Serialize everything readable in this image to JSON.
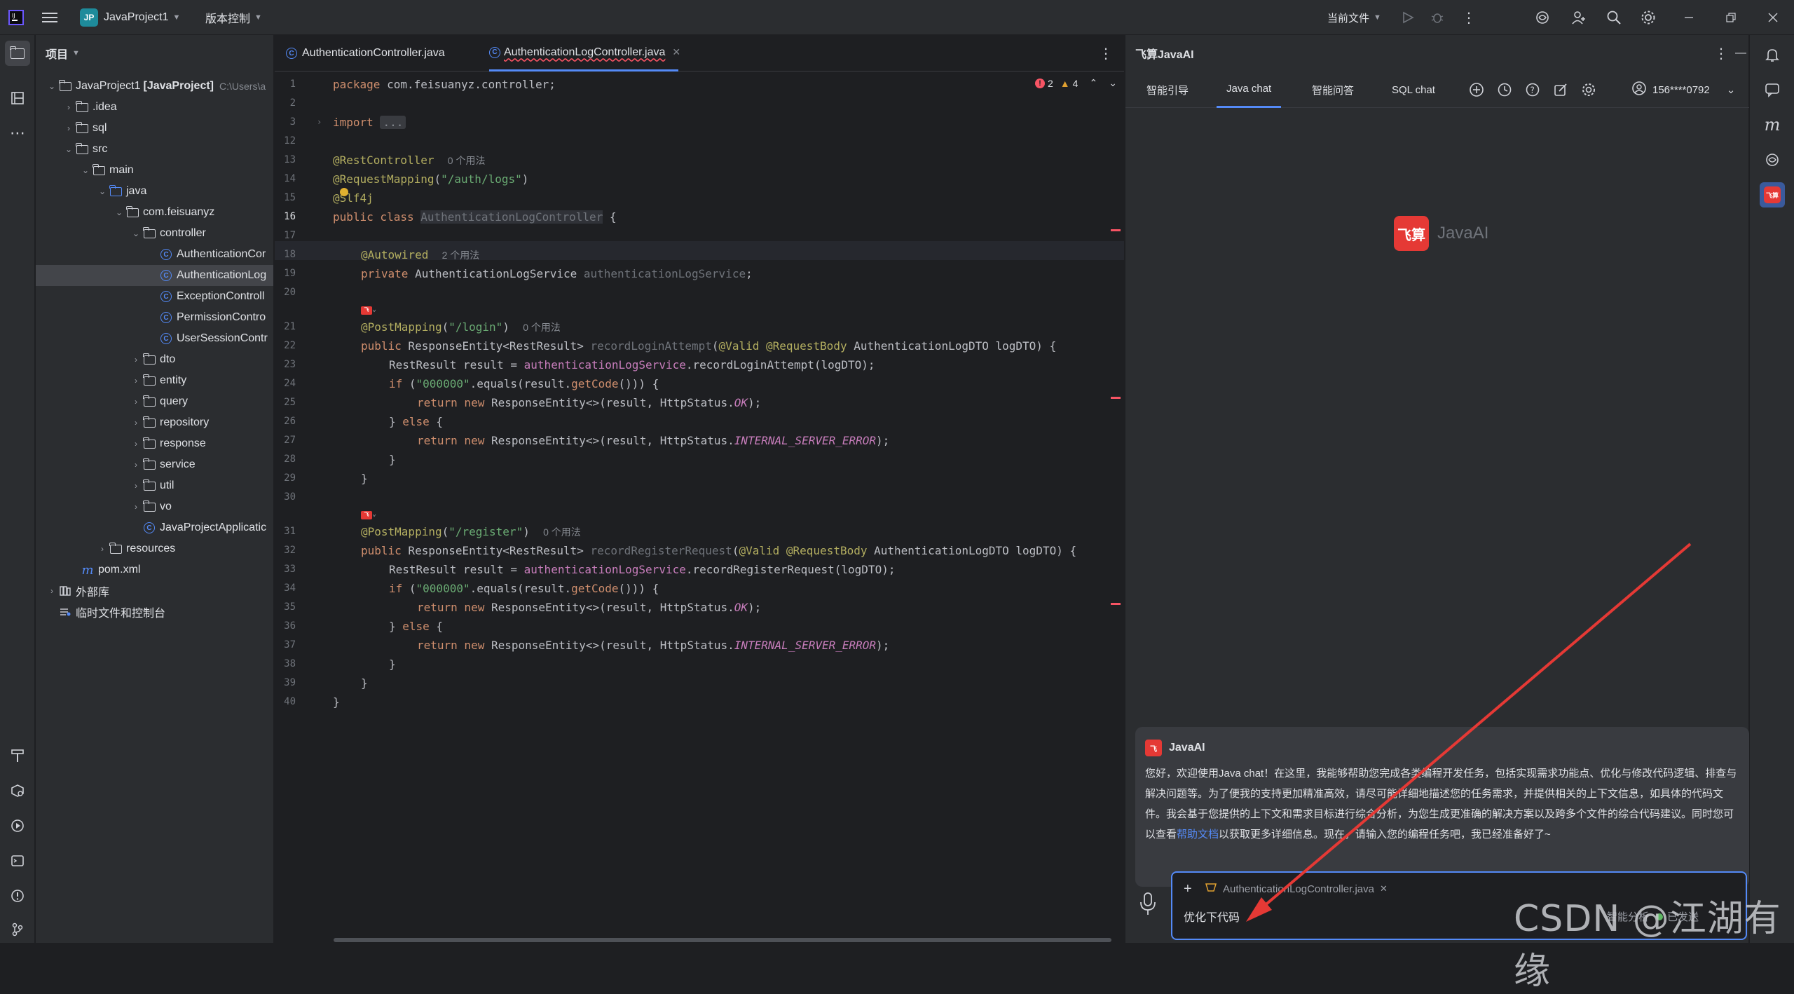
{
  "topbar": {
    "project_badge": "JP",
    "project_name": "JavaProject1",
    "vcs_label": "版本控制",
    "run_config": "当前文件"
  },
  "project_panel": {
    "title": "项目",
    "rows": [
      {
        "label": "JavaProject1",
        "extra": "[JavaProject]",
        "path": "C:\\Users\\a"
      },
      {
        "label": ".idea"
      },
      {
        "label": "sql"
      },
      {
        "label": "src"
      },
      {
        "label": "main"
      },
      {
        "label": "java"
      },
      {
        "label": "com.feisuanyz"
      },
      {
        "label": "controller"
      },
      {
        "label": "AuthenticationCor"
      },
      {
        "label": "AuthenticationLog"
      },
      {
        "label": "ExceptionControll"
      },
      {
        "label": "PermissionContro"
      },
      {
        "label": "UserSessionContr"
      },
      {
        "label": "dto"
      },
      {
        "label": "entity"
      },
      {
        "label": "query"
      },
      {
        "label": "repository"
      },
      {
        "label": "response"
      },
      {
        "label": "service"
      },
      {
        "label": "util"
      },
      {
        "label": "vo"
      },
      {
        "label": "JavaProjectApplicatic"
      },
      {
        "label": "resources"
      },
      {
        "label": "pom.xml"
      },
      {
        "label": "外部库"
      },
      {
        "label": "临时文件和控制台"
      }
    ]
  },
  "editor": {
    "tabs": [
      "AuthenticationController.java",
      "AuthenticationLogController.java"
    ],
    "errors": "2",
    "warnings": "4",
    "line_numbers": [
      "1",
      "2",
      "3",
      "12",
      "13",
      "14",
      "15",
      "16",
      "17",
      "18",
      "19",
      "20",
      "21",
      "22",
      "23",
      "24",
      "25",
      "26",
      "27",
      "28",
      "29",
      "30",
      "31",
      "32",
      "33",
      "34",
      "35",
      "36",
      "37",
      "38",
      "39",
      "40"
    ],
    "usages_2": "2 个用法",
    "usages_0": "0 个用法",
    "import_fold": "..."
  },
  "ai_panel": {
    "title": "飞算JavaAI",
    "tabs": [
      "智能引导",
      "Java chat",
      "智能问答",
      "SQL chat"
    ],
    "user": "156****0792",
    "logo_badge": "飞算",
    "logo_text": "JavaAI",
    "message": {
      "sender": "JavaAI",
      "text_1": "您好，欢迎使用Java chat！在这里，我能够帮助您完成各类编程开发任务，包括实现需求功能点、优化与修改代码逻辑、排查与解决问题等。为了便我的支持更加精准高效，请尽可能详细地描述您的任务需求，并提供相关的上下文信息，如具体的代码文件。我会基于您提供的上下文和需求目标进行综合分析，为您生成更准确的解决方案以及跨多个文件的综合代码建议。同时您可以查看",
      "link": "帮助文档",
      "text_2": "以获取更多详细信息。现在，请输入您的编程任务吧，我已经准备好了~"
    },
    "context_file": "AuthenticationLogController.java",
    "input_value": "优化下代码",
    "smart_toggle": "智能分析",
    "send_label": "已发送"
  },
  "watermark": "CSDN @江湖有缘",
  "colors": {
    "accent": "#548af7",
    "brand_red": "#e53935",
    "annotation_arrow": "#e53935"
  }
}
